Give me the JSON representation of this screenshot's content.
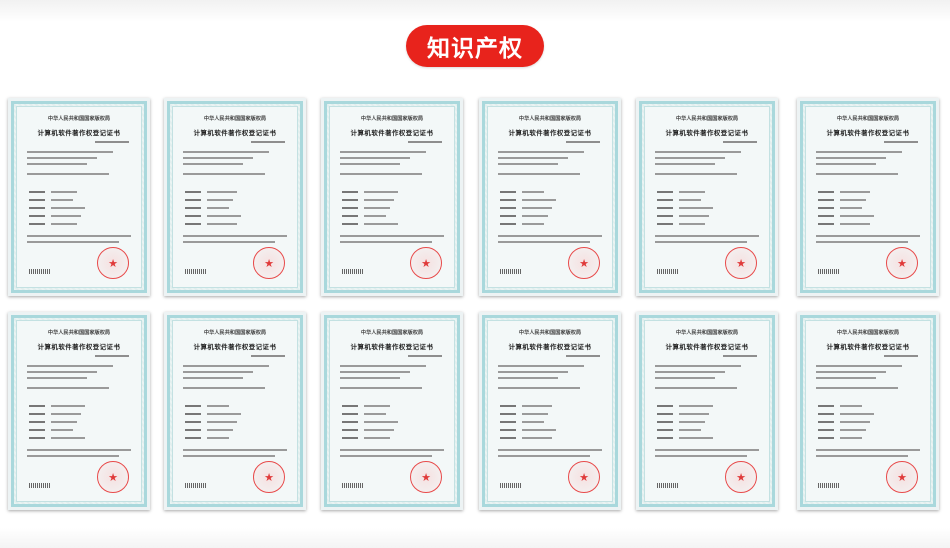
{
  "header": {
    "title": "知识产权",
    "accent_color": "#e8231c"
  },
  "certificates": {
    "org_line": "中华人民共和国国家版权局",
    "title_line": "计算机软件著作权登记证书",
    "stamp_icon": "red-star-seal-icon",
    "count": 12
  }
}
